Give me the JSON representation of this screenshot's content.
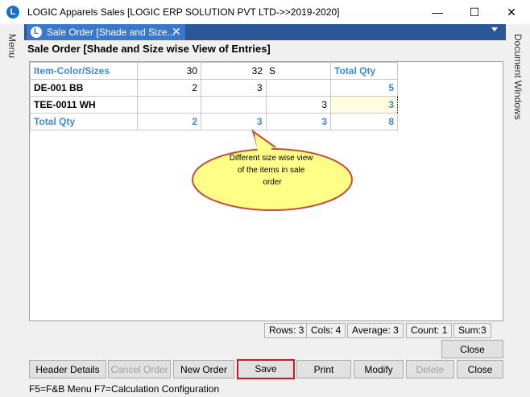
{
  "window": {
    "title": "LOGIC Apparels Sales  [LOGIC ERP SOLUTION PVT LTD->>2019-2020]",
    "app_icon_letter": "L",
    "minimize": "—",
    "maximize": "☐",
    "close": "✕"
  },
  "sidebar": {
    "left_label": "Menu",
    "right_label": "Document Windows"
  },
  "tab": {
    "icon_letter": "L",
    "label": "Sale Order [Shade and Size...",
    "close": "✕"
  },
  "form": {
    "title": "Sale Order [Shade and Size wise View of Entries]"
  },
  "grid": {
    "header": [
      "Item-Color/Sizes",
      "30",
      "32",
      "S",
      "Total Qty"
    ],
    "rows": [
      {
        "name": "DE-001 BB",
        "cells": [
          "2",
          "3",
          "",
          "5"
        ]
      },
      {
        "name": "TEE-0011 WH",
        "cells": [
          "",
          "",
          "3",
          "3"
        ]
      }
    ],
    "total": {
      "label": "Total Qty",
      "cells": [
        "2",
        "3",
        "3",
        "8"
      ]
    }
  },
  "callout": {
    "text_lines": [
      "Different  size  wise  view",
      "of  the  items  in  sale",
      "order"
    ]
  },
  "status": {
    "rows": "Rows: 3",
    "cols": "Cols: 4",
    "average": "Average: 3",
    "count": "Count: 1",
    "sum": "Sum:3"
  },
  "buttons": {
    "close_top": "Close",
    "header_details": "Header Details",
    "cancel_order": "Cancel Order",
    "new_order": "New Order",
    "save": "Save",
    "print": "Print",
    "modify": "Modify",
    "delete": "Delete",
    "close": "Close"
  },
  "hint": "F5=F&B Menu  F7=Calculation Configuration",
  "colors": {
    "accent": "#3a8ad6",
    "tabstrip": "#2b5797",
    "tab": "#3c78c9",
    "callout_fill": "#ffff88",
    "callout_stroke": "#c84c3c",
    "save_border": "#d0181b"
  }
}
